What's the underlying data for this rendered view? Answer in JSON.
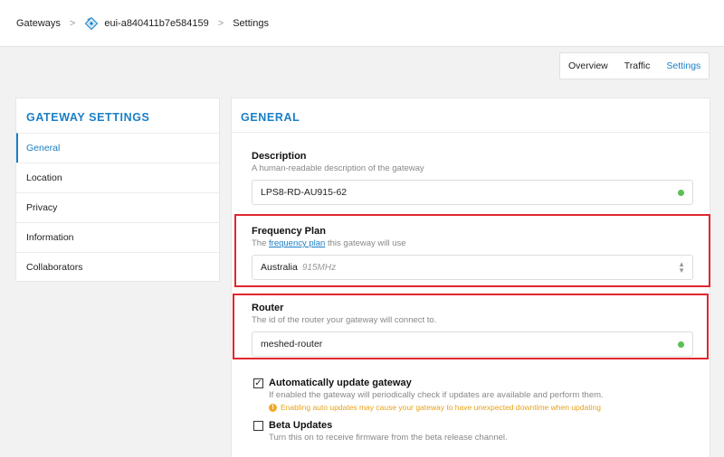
{
  "breadcrumb": {
    "items": [
      "Gateways",
      "eui-a840411b7e584159",
      "Settings"
    ]
  },
  "tabs": [
    "Overview",
    "Traffic",
    "Settings"
  ],
  "sidebar": {
    "title": "GATEWAY SETTINGS",
    "items": [
      "General",
      "Location",
      "Privacy",
      "Information",
      "Collaborators"
    ]
  },
  "main": {
    "title": "GENERAL",
    "description": {
      "label": "Description",
      "help": "A human-readable description of the gateway",
      "value": "LPS8-RD-AU915-62"
    },
    "frequency_plan": {
      "label": "Frequency Plan",
      "help_prefix": "The",
      "help_link": "frequency plan",
      "help_suffix": "this gateway will use",
      "value": "Australia",
      "value_hint": "915MHz"
    },
    "router": {
      "label": "Router",
      "help": "The id of the router your gateway will connect to.",
      "value": "meshed-router"
    },
    "auto_update": {
      "label": "Automatically update gateway",
      "help": "If enabled the gateway will periodically check if updates are available and perform them.",
      "warning": "Enabling auto updates may cause your gateway to have unexpected downtime when updating",
      "checked": true
    },
    "beta_updates": {
      "label": "Beta Updates",
      "help": "Turn this on to receive firmware from the beta release channel.",
      "checked": false
    }
  },
  "colors": {
    "accent": "#1a7fc6",
    "highlight": "#e0262e",
    "valid": "#5cbf55",
    "warning": "#e8a21a"
  }
}
